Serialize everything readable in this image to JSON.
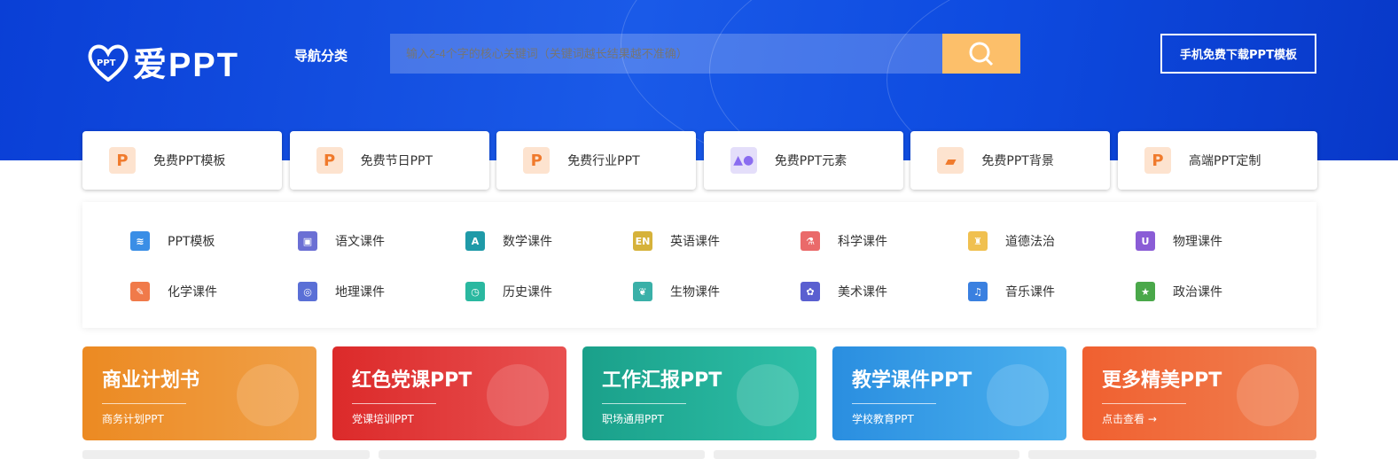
{
  "header": {
    "logo_text": "爱PPT",
    "logo_badge": "PPT",
    "nav_label": "导航分类",
    "search_placeholder": "输入2-4个字的核心关键词（关键词越长结果越不准确）",
    "download_label": "手机免费下载PPT模板"
  },
  "categories": [
    {
      "label": "免费PPT模板",
      "icon": "P"
    },
    {
      "label": "免费节日PPT",
      "icon": "P"
    },
    {
      "label": "免费行业PPT",
      "icon": "P"
    },
    {
      "label": "免费PPT元素",
      "icon": "shapes"
    },
    {
      "label": "免费PPT背景",
      "icon": "image"
    },
    {
      "label": "高端PPT定制",
      "icon": "P"
    }
  ],
  "subjects": [
    {
      "label": "PPT模板",
      "color": "#3a8ee6",
      "glyph": "≋"
    },
    {
      "label": "语文课件",
      "color": "#6b6fd4",
      "glyph": "▣"
    },
    {
      "label": "数学课件",
      "color": "#1f9aa8",
      "glyph": "A"
    },
    {
      "label": "英语课件",
      "color": "#d6b23a",
      "glyph": "EN"
    },
    {
      "label": "科学课件",
      "color": "#ea6a6a",
      "glyph": "⚗"
    },
    {
      "label": "道德法治",
      "color": "#f0c050",
      "glyph": "♜"
    },
    {
      "label": "物理课件",
      "color": "#8a5cd6",
      "glyph": "U"
    },
    {
      "label": "化学课件",
      "color": "#f07a4a",
      "glyph": "✎"
    },
    {
      "label": "地理课件",
      "color": "#5a6fd6",
      "glyph": "◎"
    },
    {
      "label": "历史课件",
      "color": "#2ab8a0",
      "glyph": "◷"
    },
    {
      "label": "生物课件",
      "color": "#3ab0a8",
      "glyph": "❦"
    },
    {
      "label": "美术课件",
      "color": "#5a5fd0",
      "glyph": "✿"
    },
    {
      "label": "音乐课件",
      "color": "#3a80e0",
      "glyph": "♫"
    },
    {
      "label": "政治课件",
      "color": "#4aa84a",
      "glyph": "★"
    }
  ],
  "banners": [
    {
      "title": "商业计划书",
      "subtitle": "商务计划PPT",
      "bg": "linear-gradient(90deg,#ec8a22,#f0a048)"
    },
    {
      "title": "红色党课PPT",
      "subtitle": "党课培训PPT",
      "bg": "linear-gradient(90deg,#dc2a2a,#e85050)"
    },
    {
      "title": "工作汇报PPT",
      "subtitle": "职场通用PPT",
      "bg": "linear-gradient(90deg,#1aa08a,#2ec0a8)"
    },
    {
      "title": "教学课件PPT",
      "subtitle": "学校教育PPT",
      "bg": "linear-gradient(90deg,#2a8ee0,#4ab0ee)"
    },
    {
      "title": "更多精美PPT",
      "subtitle": "点击查看 →",
      "bg": "linear-gradient(90deg,#f06030,#f08050)"
    }
  ]
}
